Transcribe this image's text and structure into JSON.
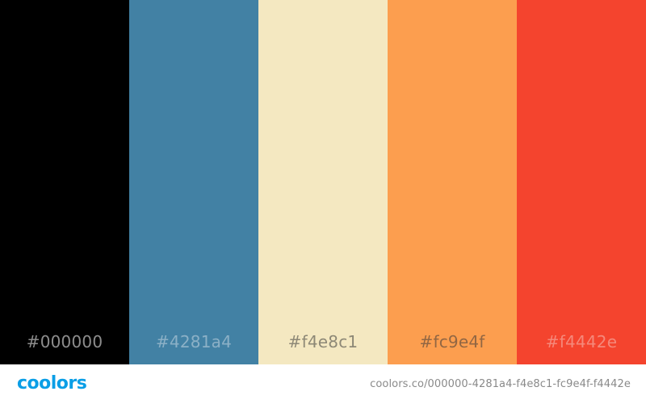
{
  "palette": [
    {
      "hex": "#000000",
      "color": "#000000",
      "label_color": "#ffffff"
    },
    {
      "hex": "#4281a4",
      "color": "#4281a4",
      "label_color": "#c8d8e2"
    },
    {
      "hex": "#f4e8c1",
      "color": "#f4e8c1",
      "label_color": "#3a3a3a"
    },
    {
      "hex": "#fc9e4f",
      "color": "#fc9e4f",
      "label_color": "#3a3a3a"
    },
    {
      "hex": "#f4442e",
      "color": "#f4442e",
      "label_color": "#f7c0b8"
    }
  ],
  "footer": {
    "logo_text": "coolors",
    "logo_color": "#0a9ee6",
    "url": "coolors.co/000000-4281a4-f4e8c1-fc9e4f-f4442e"
  }
}
